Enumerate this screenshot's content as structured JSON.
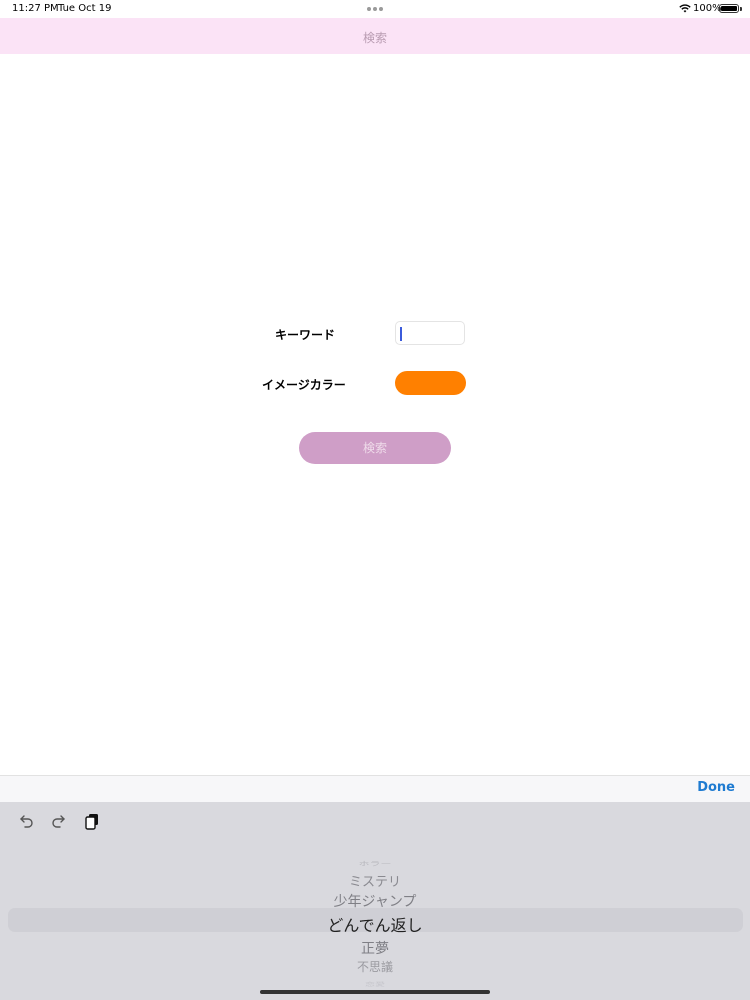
{
  "status_bar": {
    "time": "11:27 PM",
    "date": "Tue Oct 19",
    "battery": "100%"
  },
  "nav": {
    "title": "検索"
  },
  "form": {
    "keyword_label": "キーワード",
    "keyword_value": "",
    "color_label": "イメージカラー",
    "color_value": "#ff8000",
    "search_button": "検索"
  },
  "accessory": {
    "done_label": "Done"
  },
  "keyboard_tools": {
    "undo": "undo-icon",
    "redo": "redo-icon",
    "paste": "paste-icon"
  },
  "picker": {
    "items": [
      "ホラー",
      "ミステリ",
      "少年ジャンプ",
      "どんでん返し",
      "正夢",
      "不思議",
      "恋愛"
    ],
    "selected": "どんでん返し"
  },
  "colors": {
    "nav_bg": "#fbe3f6",
    "search_button_bg": "#cf9ec7",
    "accent": "#1f7bd1"
  }
}
